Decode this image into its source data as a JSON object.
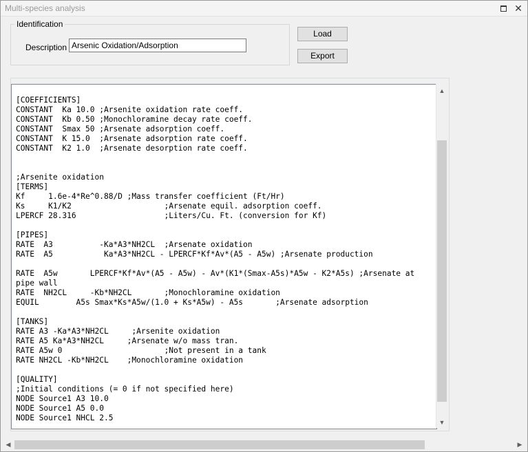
{
  "window": {
    "title": "Multi-species analysis"
  },
  "icons": {
    "restore": "restore-icon",
    "close": "close-icon",
    "scroll_up": "chevron-up-icon",
    "scroll_down": "chevron-down-icon",
    "scroll_left": "chevron-left-icon",
    "scroll_right": "chevron-right-icon"
  },
  "identification": {
    "legend": "Identification",
    "description_label": "Description",
    "description_value": "Arsenic Oxidation/Adsorption"
  },
  "buttons": {
    "load": "Load",
    "export": "Export"
  },
  "editor": {
    "lines": [
      "[COEFFICIENTS]",
      "CONSTANT  Ka 10.0 ;Arsenite oxidation rate coeff.",
      "CONSTANT  Kb 0.50 ;Monochloramine decay rate coeff.",
      "CONSTANT  Smax 50 ;Arsenate adsorption coeff.",
      "CONSTANT  K 15.0  ;Arsenate adsorption rate coeff.",
      "CONSTANT  K2 1.0  ;Arsenate desorption rate coeff.",
      "",
      "",
      ";Arsenite oxidation",
      "[TERMS]",
      "Kf     1.6e-4*Re^0.88/D ;Mass transfer coefficient (Ft/Hr)",
      "Ks     K1/K2                    ;Arsenate equil. adsorption coeff.",
      "LPERCF 28.316                   ;Liters/Cu. Ft. (conversion for Kf)",
      "",
      "[PIPES]",
      "RATE  A3          -Ka*A3*NH2CL  ;Arsenate oxidation",
      "RATE  A5           Ka*A3*NH2CL - LPERCF*Kf*Av*(A5 - A5w) ;Arsenate production",
      "",
      "RATE  A5w       LPERCF*Kf*Av*(A5 - A5w) - Av*(K1*(Smax-A5s)*A5w - K2*A5s) ;Arsenate at",
      "pipe wall",
      "RATE  NH2CL     -Kb*NH2CL       ;Monochloramine oxidation",
      "EQUIL        A5s Smax*Ks*A5w/(1.0 + Ks*A5w) - A5s       ;Arsenate adsorption",
      "",
      "[TANKS]",
      "RATE A3 -Ka*A3*NH2CL     ;Arsenite oxidation",
      "RATE A5 Ka*A3*NH2CL     ;Arsenate w/o mass tran.",
      "RATE A5w 0                      ;Not present in a tank",
      "RATE NH2CL -Kb*NH2CL    ;Monochloramine oxidation",
      "",
      "[QUALITY]",
      ";Initial conditions (= 0 if not specified here)",
      "NODE Source1 A3 10.0",
      "NODE Source1 A5 0.0",
      "NODE Source1 NHCL 2.5"
    ]
  }
}
